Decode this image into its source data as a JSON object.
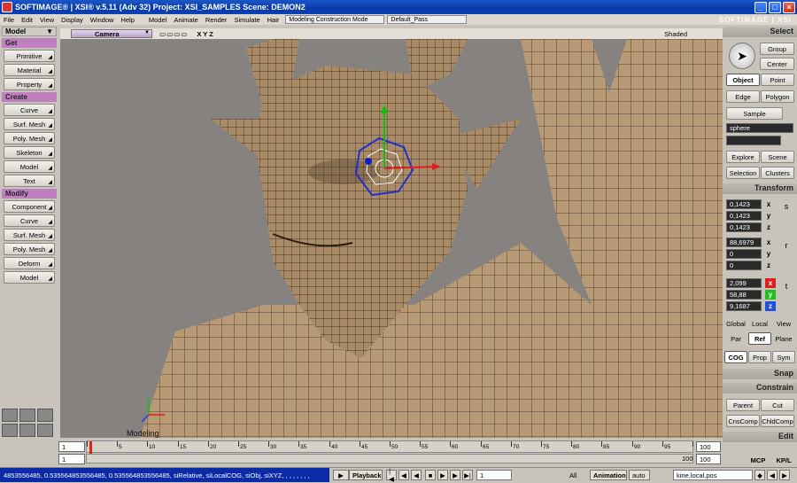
{
  "window": {
    "title": "SOFTIMAGE® | XSI® v.5.11 (Adv 32) Project: XSI_SAMPLES    Scene: DEMON2",
    "brand": "SOFTIMAGE | XSI"
  },
  "menu": {
    "items": [
      "File",
      "Edit",
      "View",
      "Display",
      "Window",
      "Help",
      "Model",
      "Animate",
      "Render",
      "Simulate",
      "Hair"
    ],
    "mode": "Modeling Construction Mode",
    "pass": "Default_Pass"
  },
  "left": {
    "module": "Model",
    "sections": [
      {
        "title": "Get",
        "buttons": [
          "Primitive",
          "Material",
          "Property"
        ]
      },
      {
        "title": "Create",
        "buttons": [
          "Curve",
          "Surf. Mesh",
          "Poly. Mesh",
          "Skeleton",
          "Model",
          "Text"
        ]
      },
      {
        "title": "Modify",
        "buttons": [
          "Component",
          "Curve",
          "Surf. Mesh",
          "Poly. Mesh",
          "Deform",
          "Model"
        ]
      }
    ]
  },
  "viewport": {
    "camera": "Camera",
    "axes": "X Y Z",
    "display": "Shaded",
    "label": "Modeling"
  },
  "right": {
    "select_title": "Select",
    "group": "Group",
    "center": "Center",
    "object": "Object",
    "point": "Point",
    "edge": "Edge",
    "polygon": "Polygon",
    "sample": "Sample",
    "name_field": "sphere",
    "explore": "Explore",
    "scene": "Scene",
    "selection": "Selection",
    "clusters": "Clusters",
    "transform_title": "Transform",
    "scale": [
      "0,1423",
      "0,1423",
      "0,1423"
    ],
    "rotate": [
      "88,6979",
      "0",
      "0"
    ],
    "translate": [
      "2,099",
      "58,88",
      "9,1687"
    ],
    "axis_labels": [
      "x",
      "y",
      "z"
    ],
    "global": "Global",
    "local": "Local",
    "view": "View",
    "par": "Par",
    "ref": "Ref",
    "plane": "Plane",
    "cog": "COG",
    "prop": "Prop",
    "sym": "Sym",
    "snap_title": "Snap",
    "constrain_title": "Constrain",
    "parent": "Parent",
    "cut": "Cut",
    "cnscomp": "CnsComp",
    "chldcomp": "ChldComp",
    "edit_title": "Edit",
    "mcp": "MCP",
    "kpl": "KP/L"
  },
  "timeline": {
    "start": "1",
    "start2": "1",
    "end": "100",
    "end2": "100",
    "end3": "100",
    "ticks": [
      "1",
      "5",
      "10",
      "15",
      "20",
      "25",
      "30",
      "35",
      "40",
      "45",
      "50",
      "55",
      "60",
      "65",
      "70",
      "75",
      "80",
      "85",
      "90",
      "95",
      "100"
    ]
  },
  "status": {
    "command": "4853556485, 0.535564853556485, 0.535564853556485, siRelative, siLocalCOG, siObj, siXYZ, , , , , , , ,",
    "playback": "Playback",
    "frame": "1",
    "all": "All",
    "animation": "Animation",
    "auto": "auto",
    "kine": "kine.local.pos"
  }
}
